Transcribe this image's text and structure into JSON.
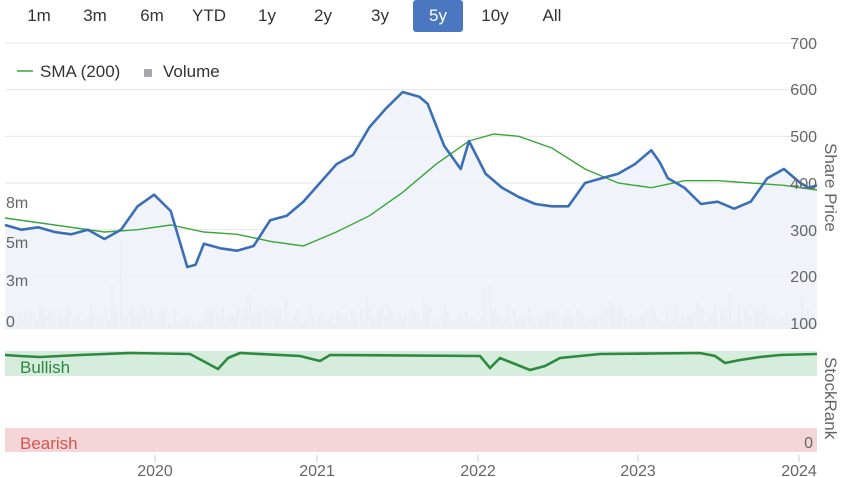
{
  "range_buttons": [
    {
      "label": "1m",
      "active": false
    },
    {
      "label": "3m",
      "active": false
    },
    {
      "label": "6m",
      "active": false
    },
    {
      "label": "YTD",
      "active": false
    },
    {
      "label": "1y",
      "active": false
    },
    {
      "label": "2y",
      "active": false
    },
    {
      "label": "3y",
      "active": false
    },
    {
      "label": "5y",
      "active": true
    },
    {
      "label": "10y",
      "active": false
    },
    {
      "label": "All",
      "active": false
    }
  ],
  "colors": {
    "price": "#3a6fb8",
    "sma": "#3aa63a",
    "volume": "#c8c8cc",
    "bullish_band": "#d6ecdc",
    "bearish_band": "#f5d6d8",
    "rank": "#2d8a3e",
    "bullish_text": "#2d8a3e",
    "bearish_text": "#d9534f",
    "active_button": "#4a77c0"
  },
  "chart_data": {
    "type": "line",
    "legend": {
      "placement": "top-left",
      "entries": [
        {
          "label": "SMA (200)",
          "marker": "line"
        },
        {
          "label": "Volume",
          "marker": "square"
        }
      ]
    },
    "x_ticks": [
      "2020",
      "2021",
      "2022",
      "2023",
      "2024"
    ],
    "price_axis": {
      "title": "Share Price",
      "ticks": [
        "700",
        "600",
        "500",
        "400",
        "300",
        "200",
        "100"
      ],
      "range": [
        100,
        700
      ]
    },
    "volume_axis": {
      "ticks": [
        "8m",
        "5m",
        "3m",
        "0"
      ],
      "range": [
        0,
        8
      ]
    },
    "rank_axis": {
      "title": "StockRank",
      "ticks": [
        "0"
      ],
      "bands": {
        "bullish": "Bullish",
        "bearish": "Bearish"
      }
    },
    "price_series": {
      "name": "Price",
      "x": [
        2019.2,
        2019.3,
        2019.4,
        2019.5,
        2019.6,
        2019.7,
        2019.8,
        2019.9,
        2020.0,
        2020.1,
        2020.2,
        2020.3,
        2020.35,
        2020.4,
        2020.5,
        2020.6,
        2020.7,
        2020.8,
        2020.9,
        2021.0,
        2021.1,
        2021.2,
        2021.3,
        2021.4,
        2021.5,
        2021.6,
        2021.7,
        2021.75,
        2021.85,
        2021.95,
        2022.0,
        2022.1,
        2022.2,
        2022.3,
        2022.4,
        2022.5,
        2022.6,
        2022.7,
        2022.8,
        2022.9,
        2023.0,
        2023.1,
        2023.15,
        2023.2,
        2023.3,
        2023.4,
        2023.5,
        2023.6,
        2023.7,
        2023.8,
        2023.9,
        2024.0,
        2024.05,
        2024.1
      ],
      "y": [
        310,
        300,
        305,
        295,
        290,
        300,
        280,
        300,
        350,
        375,
        340,
        220,
        225,
        270,
        260,
        255,
        265,
        320,
        330,
        360,
        400,
        440,
        460,
        520,
        560,
        595,
        585,
        570,
        480,
        430,
        490,
        420,
        390,
        370,
        355,
        350,
        350,
        400,
        410,
        420,
        440,
        470,
        445,
        410,
        390,
        355,
        360,
        345,
        360,
        410,
        430,
        400,
        390,
        395
      ]
    },
    "sma_series": {
      "name": "SMA (200)",
      "x": [
        2019.2,
        2019.5,
        2019.8,
        2020.0,
        2020.2,
        2020.4,
        2020.6,
        2020.8,
        2021.0,
        2021.2,
        2021.4,
        2021.6,
        2021.8,
        2022.0,
        2022.15,
        2022.3,
        2022.5,
        2022.7,
        2022.9,
        2023.1,
        2023.3,
        2023.5,
        2023.7,
        2023.9,
        2024.1
      ],
      "y": [
        325,
        310,
        295,
        300,
        310,
        295,
        290,
        275,
        265,
        295,
        330,
        380,
        440,
        490,
        505,
        500,
        475,
        430,
        400,
        390,
        405,
        405,
        400,
        395,
        385
      ]
    },
    "volume_series": {
      "name": "Volume",
      "description": "daily bars, mostly 0.5m-2m with spikes near 5m",
      "peak_values": [
        5.5,
        3.8,
        4.0,
        5.8,
        5.0,
        4.5
      ]
    },
    "rank_series": {
      "name": "StockRank",
      "values": "mostly near top of bullish band with dips around 2020.4, 2022.1, 2023.8"
    }
  }
}
